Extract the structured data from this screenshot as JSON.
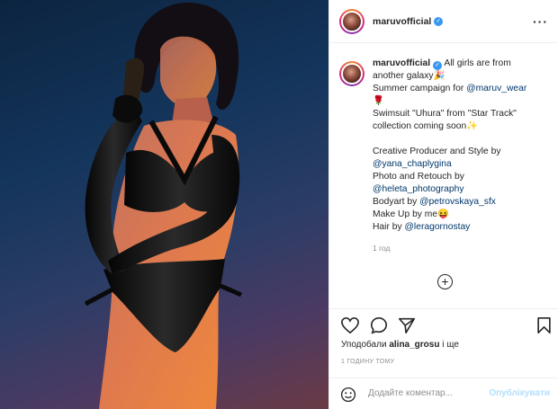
{
  "post": {
    "username": "maruvofficial",
    "more_icon": "more-dots-icon",
    "caption_lines": [
      "All girls are from",
      "another galaxy🎉",
      "Summer campaign for ",
      "@maruv_wear",
      "🌹",
      "Swimsuit \"Uhura\" from \"Star Track\"",
      "collection coming soon✨",
      "Creative Producer and Style by",
      "@yana_chaplygina",
      "Photo and Retouch by",
      "@heleta_photography",
      "Bodyart by ",
      "@petrovskaya_sfx",
      "Make Up by me😝",
      "Hair by ",
      "@leragornostay"
    ],
    "caption_time": "1 год",
    "likes_prefix": "Уподобали ",
    "likes_user": "alina_grosu",
    "likes_suffix": " і ще",
    "timestamp": "1 ГОДИНУ ТОМУ",
    "comment_placeholder": "Додайте коментар...",
    "post_button": "Опублікувати"
  },
  "colors": {
    "link": "#00376b",
    "verified": "#3897f0",
    "post_button": "#b2dffc",
    "muted": "#8e8e8e"
  }
}
